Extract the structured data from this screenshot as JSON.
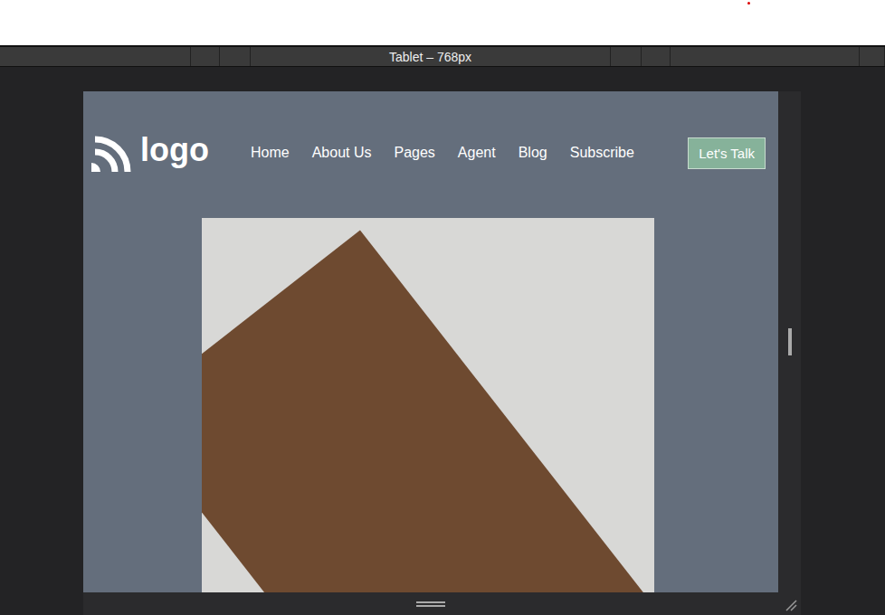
{
  "toolbar": {
    "device_label": "Tablet – 768px"
  },
  "site": {
    "logo_text": "logo",
    "nav": [
      {
        "label": "Home"
      },
      {
        "label": "About Us"
      },
      {
        "label": "Pages"
      },
      {
        "label": "Agent"
      },
      {
        "label": "Blog"
      },
      {
        "label": "Subscribe"
      }
    ],
    "cta": "Let's Talk"
  }
}
